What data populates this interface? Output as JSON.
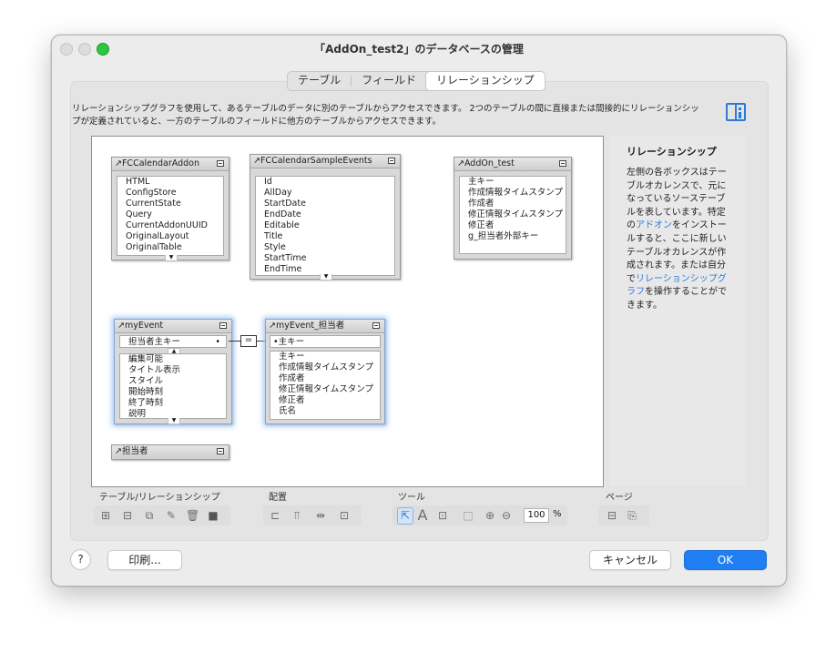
{
  "window": {
    "title": "「AddOn_test2」のデータベースの管理"
  },
  "tabs": [
    {
      "label": "テーブル"
    },
    {
      "label": "フィールド"
    },
    {
      "label": "リレーションシップ"
    }
  ],
  "description": "リレーションシップグラフを使用して、あるテーブルのデータに別のテーブルからアクセスできます。 2つのテーブルの間に直接または間接的にリレーションシップが定義されていると、一方のテーブルのフィールドに他方のテーブルからアクセスできます。",
  "tables": {
    "fccalendaraddon": {
      "name": "FCCalendarAddon",
      "fields": [
        "HTML",
        "ConfigStore",
        "CurrentState",
        "Query",
        "CurrentAddonUUID",
        "OriginalLayout",
        "OriginalTable"
      ]
    },
    "fccalendarsampleevents": {
      "name": "FCCalendarSampleEvents",
      "fields": [
        "Id",
        "AllDay",
        "StartDate",
        "EndDate",
        "Editable",
        "Title",
        "Style",
        "StartTime",
        "EndTime"
      ]
    },
    "addon_test": {
      "name": "AddOn_test",
      "fields": [
        "主キー",
        "作成情報タイムスタンプ",
        "作成者",
        "修正情報タイムスタンプ",
        "修正者",
        "g_担当者外部キー"
      ]
    },
    "myevent": {
      "name": "myEvent",
      "key_field": "担当者主キー",
      "fields": [
        "編集可能",
        "タイトル表示",
        "スタイル",
        "開始時刻",
        "終了時刻",
        "説明"
      ]
    },
    "myevent_tantousha": {
      "name": "myEvent_担当者",
      "key_field": "主キー",
      "fields": [
        "主キー",
        "作成情報タイムスタンプ",
        "作成者",
        "修正情報タイムスタンプ",
        "修正者",
        "氏名"
      ]
    },
    "tantousha": {
      "name": "担当者"
    }
  },
  "relationship_operator": "=",
  "sidebar": {
    "title": "リレーションシップ",
    "text_1": "左側の各ボックスはテーブルオカレンスで、元になっているソーステーブルを表しています。特定の",
    "link_1": "アドオン",
    "text_2": "をインストールすると、ここに新しいテーブルオカレンスが作成されます。または自分で",
    "link_2": "リレーションシップグラフ",
    "text_3": "を操作することができます。"
  },
  "toolbar": {
    "group_table_relationship": "テーブル/リレーションシップ",
    "group_arrange": "配置",
    "group_tools": "ツール",
    "group_page": "ページ",
    "zoom_value": "100",
    "zoom_unit": "%"
  },
  "buttons": {
    "help": "?",
    "print": "印刷...",
    "cancel": "キャンセル",
    "ok": "OK"
  },
  "colors": {
    "accent": "#1f7ff2",
    "link": "#2b7bd8",
    "selection_glow": "#a9c8ef"
  }
}
